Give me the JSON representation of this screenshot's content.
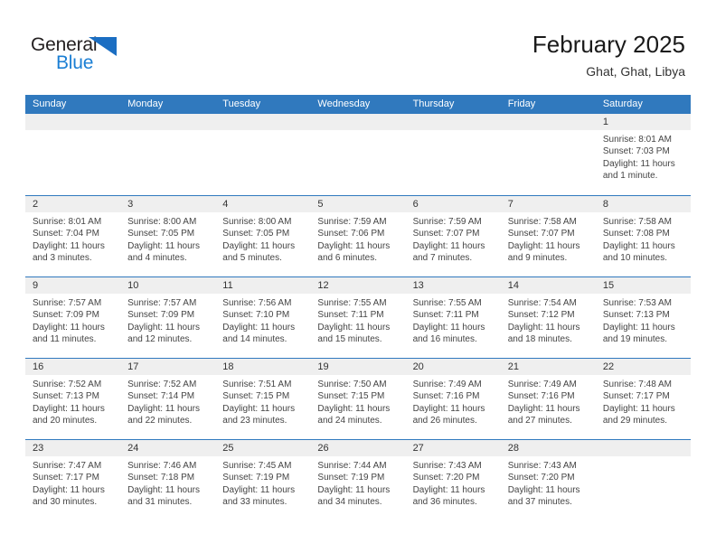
{
  "brand": {
    "name_dark": "General",
    "name_blue": "Blue",
    "accent_color": "#1b6ec2",
    "header_color": "#3079be"
  },
  "header": {
    "title": "February 2025",
    "subtitle": "Ghat, Ghat, Libya"
  },
  "calendar": {
    "weekdays": [
      "Sunday",
      "Monday",
      "Tuesday",
      "Wednesday",
      "Thursday",
      "Friday",
      "Saturday"
    ],
    "weeks": [
      [
        {
          "day": "",
          "lines": []
        },
        {
          "day": "",
          "lines": []
        },
        {
          "day": "",
          "lines": []
        },
        {
          "day": "",
          "lines": []
        },
        {
          "day": "",
          "lines": []
        },
        {
          "day": "",
          "lines": []
        },
        {
          "day": "1",
          "lines": [
            "Sunrise: 8:01 AM",
            "Sunset: 7:03 PM",
            "Daylight: 11 hours",
            "and 1 minute."
          ]
        }
      ],
      [
        {
          "day": "2",
          "lines": [
            "Sunrise: 8:01 AM",
            "Sunset: 7:04 PM",
            "Daylight: 11 hours",
            "and 3 minutes."
          ]
        },
        {
          "day": "3",
          "lines": [
            "Sunrise: 8:00 AM",
            "Sunset: 7:05 PM",
            "Daylight: 11 hours",
            "and 4 minutes."
          ]
        },
        {
          "day": "4",
          "lines": [
            "Sunrise: 8:00 AM",
            "Sunset: 7:05 PM",
            "Daylight: 11 hours",
            "and 5 minutes."
          ]
        },
        {
          "day": "5",
          "lines": [
            "Sunrise: 7:59 AM",
            "Sunset: 7:06 PM",
            "Daylight: 11 hours",
            "and 6 minutes."
          ]
        },
        {
          "day": "6",
          "lines": [
            "Sunrise: 7:59 AM",
            "Sunset: 7:07 PM",
            "Daylight: 11 hours",
            "and 7 minutes."
          ]
        },
        {
          "day": "7",
          "lines": [
            "Sunrise: 7:58 AM",
            "Sunset: 7:07 PM",
            "Daylight: 11 hours",
            "and 9 minutes."
          ]
        },
        {
          "day": "8",
          "lines": [
            "Sunrise: 7:58 AM",
            "Sunset: 7:08 PM",
            "Daylight: 11 hours",
            "and 10 minutes."
          ]
        }
      ],
      [
        {
          "day": "9",
          "lines": [
            "Sunrise: 7:57 AM",
            "Sunset: 7:09 PM",
            "Daylight: 11 hours",
            "and 11 minutes."
          ]
        },
        {
          "day": "10",
          "lines": [
            "Sunrise: 7:57 AM",
            "Sunset: 7:09 PM",
            "Daylight: 11 hours",
            "and 12 minutes."
          ]
        },
        {
          "day": "11",
          "lines": [
            "Sunrise: 7:56 AM",
            "Sunset: 7:10 PM",
            "Daylight: 11 hours",
            "and 14 minutes."
          ]
        },
        {
          "day": "12",
          "lines": [
            "Sunrise: 7:55 AM",
            "Sunset: 7:11 PM",
            "Daylight: 11 hours",
            "and 15 minutes."
          ]
        },
        {
          "day": "13",
          "lines": [
            "Sunrise: 7:55 AM",
            "Sunset: 7:11 PM",
            "Daylight: 11 hours",
            "and 16 minutes."
          ]
        },
        {
          "day": "14",
          "lines": [
            "Sunrise: 7:54 AM",
            "Sunset: 7:12 PM",
            "Daylight: 11 hours",
            "and 18 minutes."
          ]
        },
        {
          "day": "15",
          "lines": [
            "Sunrise: 7:53 AM",
            "Sunset: 7:13 PM",
            "Daylight: 11 hours",
            "and 19 minutes."
          ]
        }
      ],
      [
        {
          "day": "16",
          "lines": [
            "Sunrise: 7:52 AM",
            "Sunset: 7:13 PM",
            "Daylight: 11 hours",
            "and 20 minutes."
          ]
        },
        {
          "day": "17",
          "lines": [
            "Sunrise: 7:52 AM",
            "Sunset: 7:14 PM",
            "Daylight: 11 hours",
            "and 22 minutes."
          ]
        },
        {
          "day": "18",
          "lines": [
            "Sunrise: 7:51 AM",
            "Sunset: 7:15 PM",
            "Daylight: 11 hours",
            "and 23 minutes."
          ]
        },
        {
          "day": "19",
          "lines": [
            "Sunrise: 7:50 AM",
            "Sunset: 7:15 PM",
            "Daylight: 11 hours",
            "and 24 minutes."
          ]
        },
        {
          "day": "20",
          "lines": [
            "Sunrise: 7:49 AM",
            "Sunset: 7:16 PM",
            "Daylight: 11 hours",
            "and 26 minutes."
          ]
        },
        {
          "day": "21",
          "lines": [
            "Sunrise: 7:49 AM",
            "Sunset: 7:16 PM",
            "Daylight: 11 hours",
            "and 27 minutes."
          ]
        },
        {
          "day": "22",
          "lines": [
            "Sunrise: 7:48 AM",
            "Sunset: 7:17 PM",
            "Daylight: 11 hours",
            "and 29 minutes."
          ]
        }
      ],
      [
        {
          "day": "23",
          "lines": [
            "Sunrise: 7:47 AM",
            "Sunset: 7:17 PM",
            "Daylight: 11 hours",
            "and 30 minutes."
          ]
        },
        {
          "day": "24",
          "lines": [
            "Sunrise: 7:46 AM",
            "Sunset: 7:18 PM",
            "Daylight: 11 hours",
            "and 31 minutes."
          ]
        },
        {
          "day": "25",
          "lines": [
            "Sunrise: 7:45 AM",
            "Sunset: 7:19 PM",
            "Daylight: 11 hours",
            "and 33 minutes."
          ]
        },
        {
          "day": "26",
          "lines": [
            "Sunrise: 7:44 AM",
            "Sunset: 7:19 PM",
            "Daylight: 11 hours",
            "and 34 minutes."
          ]
        },
        {
          "day": "27",
          "lines": [
            "Sunrise: 7:43 AM",
            "Sunset: 7:20 PM",
            "Daylight: 11 hours",
            "and 36 minutes."
          ]
        },
        {
          "day": "28",
          "lines": [
            "Sunrise: 7:43 AM",
            "Sunset: 7:20 PM",
            "Daylight: 11 hours",
            "and 37 minutes."
          ]
        },
        {
          "day": "",
          "lines": []
        }
      ]
    ]
  }
}
